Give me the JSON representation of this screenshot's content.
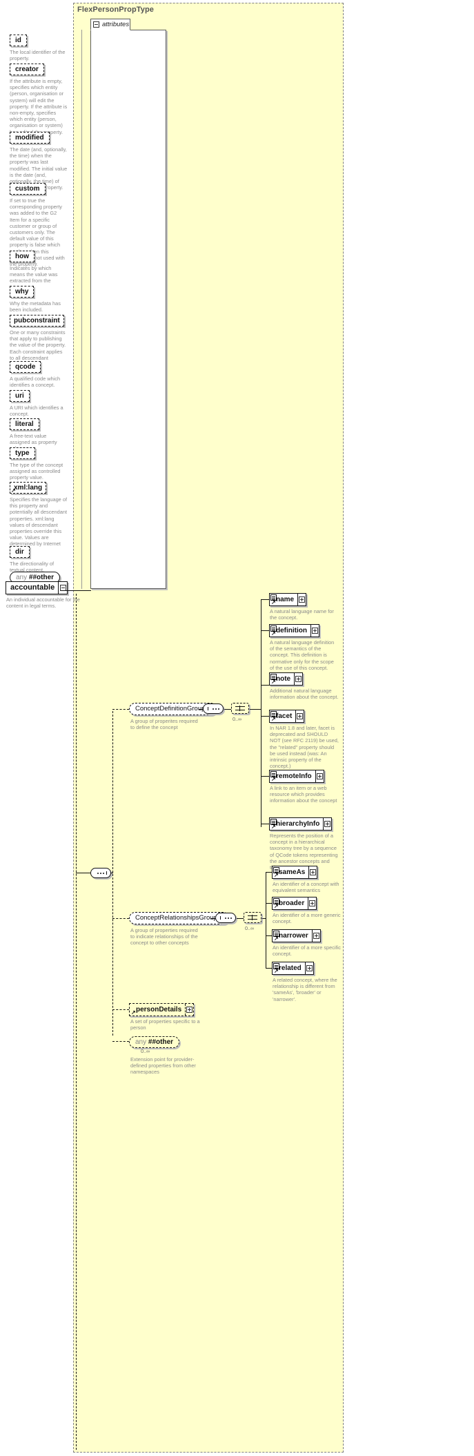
{
  "type_panel": {
    "title": "FlexPersonPropType"
  },
  "attributes_section": {
    "label": "attributes",
    "items": [
      {
        "name": "id",
        "desc": "The local identifier of the property."
      },
      {
        "name": "creator",
        "desc": "If the attribute is empty, specifies which entity (person, organisation or system) will edit the property. If the attribute is non-empty, specifies which entity (person, organisation or system) has edited the property."
      },
      {
        "name": "modified",
        "desc": "The date (and, optionally, the time) when the property was last modified. The initial value is the date (and, optionally, the time) of creation of the property."
      },
      {
        "name": "custom",
        "desc": "If set to true the corresponding property was added to the G2 Item for a specific customer or group of customers only. The default value of this property is false which applies when this attribute is not used with the property."
      },
      {
        "name": "how",
        "desc": "Indicates by which means the value was extracted from the content."
      },
      {
        "name": "why",
        "desc": "Why the metadata has been included."
      },
      {
        "name": "pubconstraint",
        "desc": "One or many constraints that apply to publishing the value of the property. Each constraint applies to all descendant elements."
      },
      {
        "name": "qcode",
        "desc": "A qualified code which identifies a concept."
      },
      {
        "name": "uri",
        "desc": "A URI which identifies a concept."
      },
      {
        "name": "literal",
        "desc": "A free-text value assigned as property value."
      },
      {
        "name": "type",
        "desc": "The type of the concept assigned as controlled property value."
      },
      {
        "name": "xml:lang",
        "desc": "Specifies the language of this property and potentially all descendant properties. xml:lang values of descendant properties override this value. Values are determined by Internet BCP 47."
      },
      {
        "name": "dir",
        "desc": "The directionality of textual content."
      }
    ],
    "any_prefix": "any",
    "any_value": "##other"
  },
  "root_element": {
    "name": "accountable",
    "desc": "An individual accountable for the content in legal terms."
  },
  "groups": [
    {
      "name": "ConceptDefinitionGroup",
      "desc": "A group of properites required to define the concept",
      "occurs": "0..∞",
      "children": [
        {
          "name": "name",
          "desc": "A natural language name for the concept."
        },
        {
          "name": "definition",
          "desc": "A natural language definition of the semantics of the concept. This definition is normative only for the scope of the use of this concept."
        },
        {
          "name": "note",
          "desc": "Additional natural language information about the concept."
        },
        {
          "name": "facet",
          "desc": "In NAR 1.8 and later, facet is deprecated and SHOULD NOT (see RFC 2119) be used, the \"related\" property should be used instead (was: An intrinsic property of the concept.)"
        },
        {
          "name": "remoteInfo",
          "desc": "A link to an item or a web resource which provides information about the concept"
        },
        {
          "name": "hierarchyInfo",
          "desc": "Represents the position of a concept in a hierarchical taxonomy tree by a sequence of QCode tokens representing the ancestor concepts and this concept"
        }
      ]
    },
    {
      "name": "ConceptRelationshipsGroup",
      "desc": "A group of properties required to indicate relationships of the concept to other concepts",
      "occurs": "0..∞",
      "children": [
        {
          "name": "sameAs",
          "desc": "An identifier of a concept with equivalent semantics"
        },
        {
          "name": "broader",
          "desc": "An identifier of a more generic concept."
        },
        {
          "name": "narrower",
          "desc": "An identifier of a more specific concept."
        },
        {
          "name": "related",
          "desc": "A related concept, where the relationship is different from 'sameAs', 'broader' or 'narrower'."
        }
      ]
    }
  ],
  "trailing": [
    {
      "name": "personDetails",
      "desc": "A set of properties specific to a person"
    }
  ],
  "any_tail": {
    "prefix": "any",
    "value": "##other",
    "occurs": "0..∞",
    "desc": "Extension point for provider-defined properties from other namespaces"
  },
  "colors": {
    "panel_bg": "#ffffcc",
    "desc_text": "#8a8a8a",
    "line": "#111111",
    "shadow": "#bdbdbd"
  }
}
